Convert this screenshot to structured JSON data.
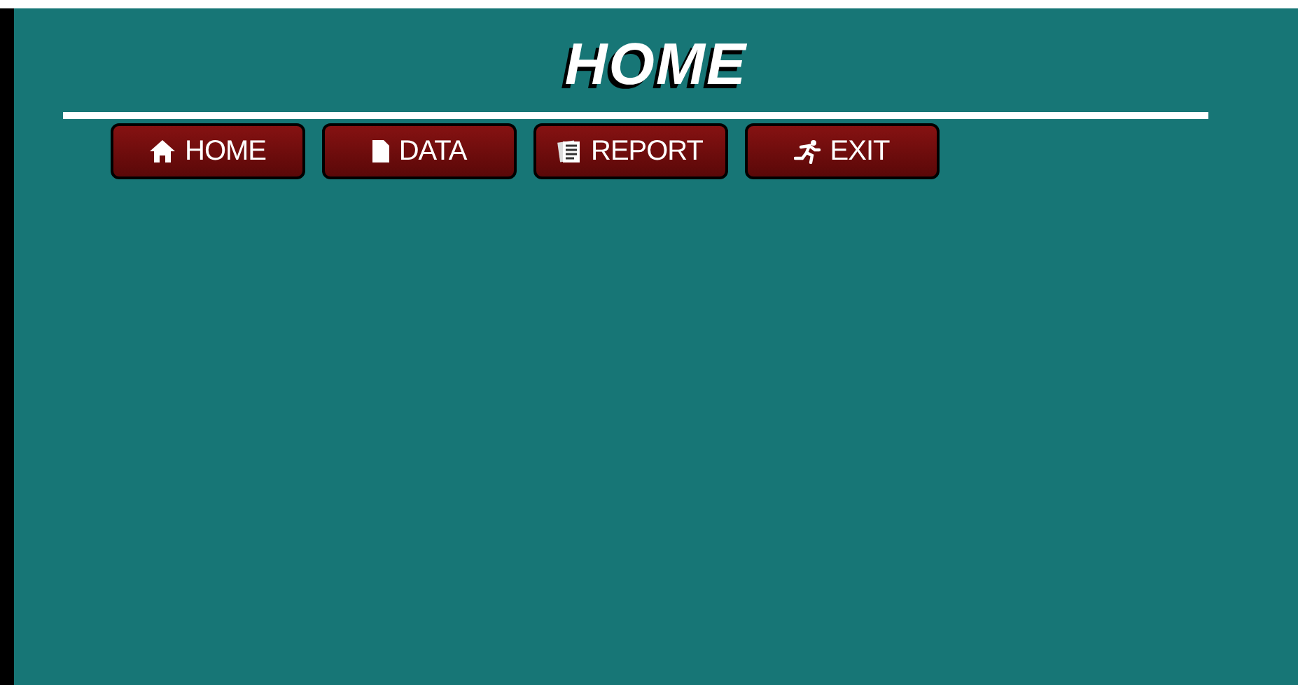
{
  "title": "HOME",
  "nav": [
    {
      "label": "HOME",
      "kind": "home"
    },
    {
      "label": "DATA",
      "kind": "data"
    },
    {
      "label": "REPORT",
      "kind": "report"
    },
    {
      "label": "EXIT",
      "kind": "exit"
    }
  ]
}
